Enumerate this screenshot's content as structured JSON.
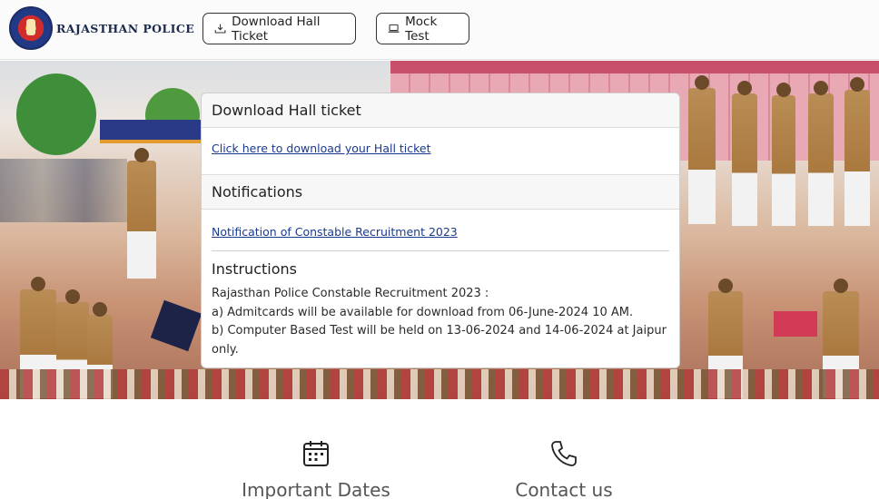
{
  "header": {
    "brand_name": "RAJASTHAN POLICE",
    "logo_icon": "police-emblem-icon",
    "buttons": [
      {
        "label": "Download Hall Ticket",
        "icon": "download-icon"
      },
      {
        "label": "Mock Test",
        "icon": "laptop-icon"
      }
    ]
  },
  "card": {
    "hall_ticket": {
      "title": "Download Hall ticket",
      "link": "Click here to download your Hall ticket"
    },
    "notifications": {
      "title": "Notifications",
      "link": "Notification of Constable Recruitment 2023"
    },
    "instructions": {
      "title": "Instructions",
      "lines": [
        "Rajasthan Police Constable Recruitment 2023 :",
        "a) Admitcards will be available for download from 06-June-2024 10 AM.",
        "b) Computer Based Test will be held on 13-06-2024 and 14-06-2024 at Jaipur only."
      ]
    }
  },
  "features": [
    {
      "label": "Important Dates",
      "icon": "calendar-icon"
    },
    {
      "label": "Contact us",
      "icon": "phone-icon"
    }
  ]
}
